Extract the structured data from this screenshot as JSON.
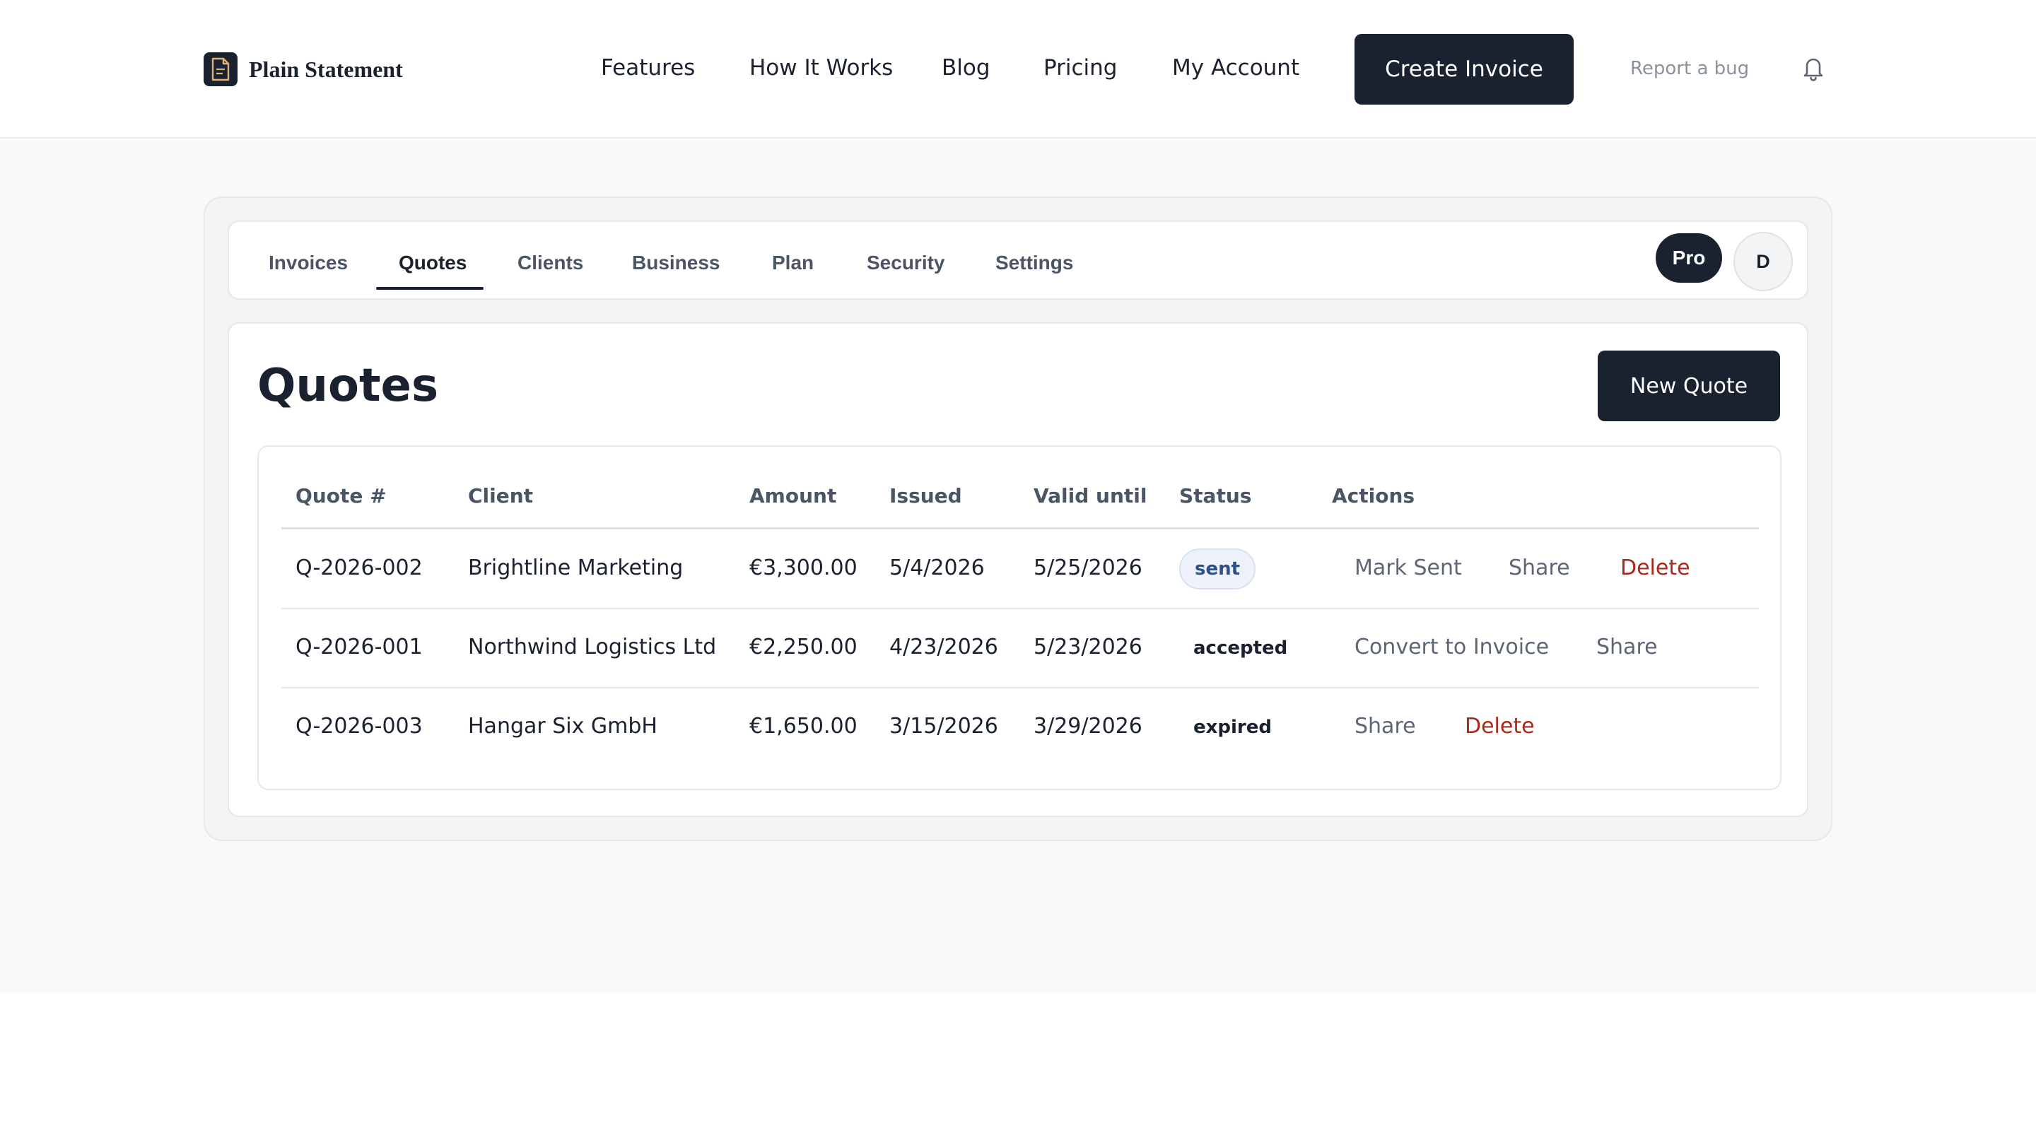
{
  "header": {
    "brand": "Plain Statement",
    "nav": [
      "Features",
      "How It Works",
      "Blog",
      "Pricing",
      "My Account"
    ],
    "cta": "Create Invoice",
    "report_bug": "Report a bug"
  },
  "tabs": {
    "items": [
      "Invoices",
      "Quotes",
      "Clients",
      "Business",
      "Plan",
      "Security",
      "Settings"
    ],
    "active": "Quotes",
    "plan_badge": "Pro",
    "avatar_initial": "D"
  },
  "main": {
    "title": "Quotes",
    "new_button": "New Quote"
  },
  "table": {
    "columns": [
      "Quote #",
      "Client",
      "Amount",
      "Issued",
      "Valid until",
      "Status",
      "Actions"
    ],
    "rows": [
      {
        "quote": "Q-2026-002",
        "client": "Brightline Marketing",
        "amount": "€3,300.00",
        "issued": "5/4/2026",
        "valid_until": "5/25/2026",
        "status": "sent",
        "actions": [
          "Mark Sent",
          "Share",
          "Delete"
        ]
      },
      {
        "quote": "Q-2026-001",
        "client": "Northwind Logistics Ltd",
        "amount": "€2,250.00",
        "issued": "4/23/2026",
        "valid_until": "5/23/2026",
        "status": "accepted",
        "actions": [
          "Convert to Invoice",
          "Share"
        ]
      },
      {
        "quote": "Q-2026-003",
        "client": "Hangar Six GmbH",
        "amount": "€1,650.00",
        "issued": "3/15/2026",
        "valid_until": "3/29/2026",
        "status": "expired",
        "actions": [
          "Share",
          "Delete"
        ]
      }
    ]
  },
  "colors": {
    "primary": "#1a2230",
    "danger": "#a8281c",
    "muted": "#5c6675",
    "page_bg": "#f9f9f8",
    "sent_badge_bg": "#eef3fb",
    "sent_badge_text": "#2d4f8a"
  },
  "icons": {
    "brand": "document-icon",
    "notifications": "bell-icon"
  }
}
